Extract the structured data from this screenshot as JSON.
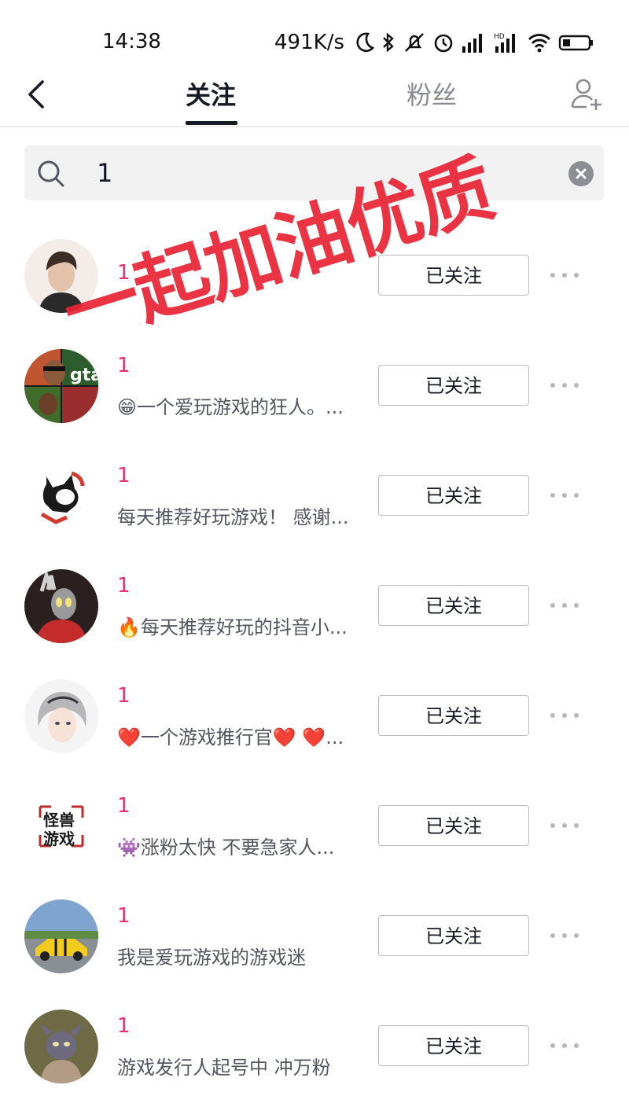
{
  "status_bar": {
    "time": "14:38",
    "speed": "491K/s",
    "icons": [
      "moon-icon",
      "bluetooth-icon",
      "mute-icon",
      "alarm-icon",
      "signal-icon",
      "hd-signal-icon",
      "wifi-icon",
      "battery-icon"
    ]
  },
  "nav": {
    "back_icon": "chevron-left-icon",
    "tabs": [
      {
        "label": "关注",
        "active": true
      },
      {
        "label": "粉丝",
        "active": false
      }
    ],
    "add_friend_icon": "add-user-icon"
  },
  "search": {
    "value": "1",
    "icon": "search-icon",
    "clear_icon": "close-icon"
  },
  "watermark": "一起加油优质",
  "list": [
    {
      "name": "1",
      "bio": "",
      "button": "已关注",
      "avatar_color": "#e9ddd8"
    },
    {
      "name": "1",
      "bio": "😁一个爱玩游戏的狂人。...",
      "button": "已关注",
      "avatar_color": "#8c3a2b"
    },
    {
      "name": "1",
      "bio": "每天推荐好玩游戏！ 感谢...",
      "button": "已关注",
      "avatar_color": "#ffffff"
    },
    {
      "name": "1",
      "bio": "🔥每天推荐好玩的抖音小...",
      "button": "已关注",
      "avatar_color": "#3a2a2a"
    },
    {
      "name": "1",
      "bio": "❤️一个游戏推行官❤️  ❤️...",
      "button": "已关注",
      "avatar_color": "#dcdcdc"
    },
    {
      "name": "1",
      "bio": "👾涨粉太快 不要急家人...",
      "button": "已关注",
      "avatar_color": "#ffffff"
    },
    {
      "name": "1",
      "bio": "我是爱玩游戏的游戏迷",
      "button": "已关注",
      "avatar_color": "#6f8fb5"
    },
    {
      "name": "1",
      "bio": "游戏发行人起号中 冲万粉",
      "button": "已关注",
      "avatar_color": "#6b6b4a"
    }
  ],
  "logo_texts": {
    "gta_logo": "gta",
    "monster_game_logo": "怪兽游戏"
  }
}
